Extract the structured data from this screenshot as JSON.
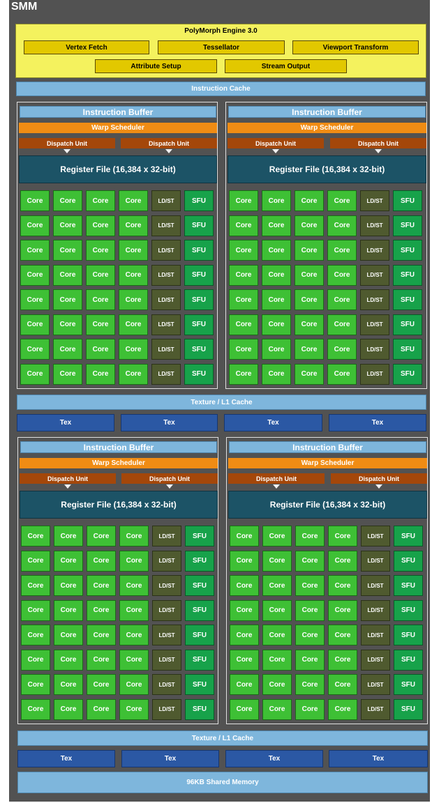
{
  "title": "SMM",
  "polymorph": {
    "title": "PolyMorph Engine 3.0",
    "units": [
      "Vertex Fetch",
      "Tessellator",
      "Viewport Transform",
      "Attribute Setup",
      "Stream Output"
    ]
  },
  "instruction_cache": "Instruction Cache",
  "processing_block": {
    "instruction_buffer": "Instruction Buffer",
    "warp_scheduler": "Warp Scheduler",
    "dispatch_unit": "Dispatch Unit",
    "register_file": "Register File (16,384 x 32-bit)",
    "core": "Core",
    "ldst": "LD/ST",
    "sfu": "SFU",
    "rows": 8,
    "cores_per_row": 4
  },
  "texture_cache": "Texture / L1 Cache",
  "tex": "Tex",
  "shared_memory": "96KB Shared Memory",
  "colors": {
    "background": "#525252",
    "polymorph": "#f4f25e",
    "polymorph_unit": "#e2c800",
    "light_blue": "#7eb6dc",
    "warp_scheduler": "#f08c14",
    "dispatch_unit": "#a4470a",
    "register_file": "#1c5366",
    "core": "#3ec035",
    "ldst": "#4f5a2f",
    "sfu": "#17a24a",
    "tex": "#2b58a4"
  }
}
